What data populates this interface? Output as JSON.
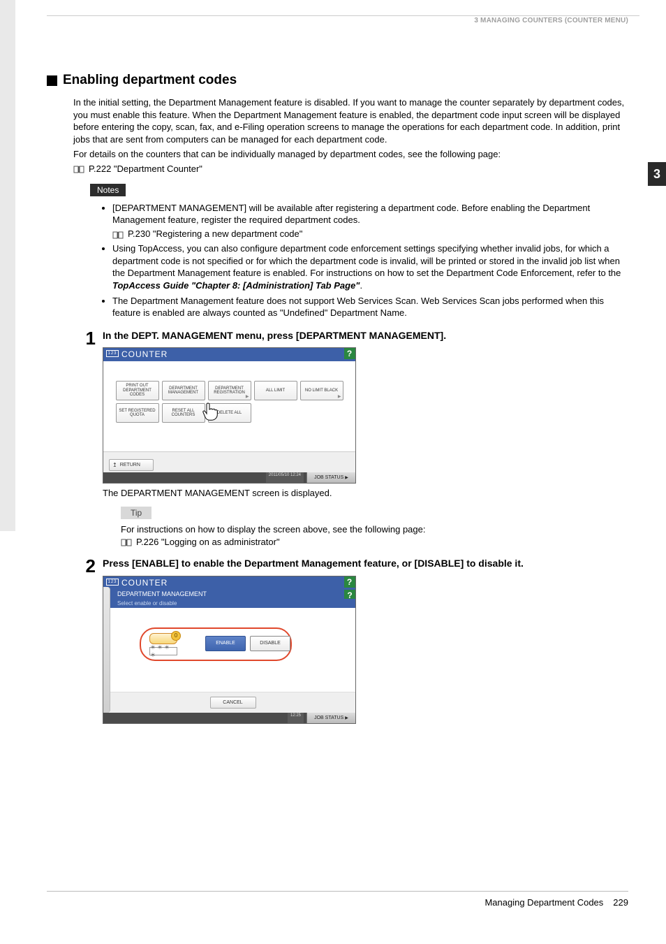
{
  "header": {
    "running_head": "3 MANAGING COUNTERS (COUNTER MENU)",
    "chapter_tab": "3"
  },
  "section": {
    "title": "Enabling department codes",
    "intro": "In the initial setting, the Department Management feature is disabled. If you want to manage the counter separately by department codes, you must enable this feature. When the Department Management feature is enabled, the department code input screen will be displayed before entering the copy, scan, fax, and e-Filing operation screens to manage the operations for each department code. In addition, print jobs that are sent from computers can be managed for each department code.",
    "detail_line": "For details on the counters that can be individually managed by department codes, see the following page:",
    "link1": "P.222 \"Department Counter\""
  },
  "notes": {
    "label": "Notes",
    "items": [
      {
        "text": "[DEPARTMENT MANAGEMENT] will be available after registering a department code. Before enabling the Department Management feature, register the required department codes.",
        "link": "P.230 \"Registering a new department code\""
      },
      {
        "text_a": "Using TopAccess, you can also configure department code enforcement settings specifying whether invalid jobs, for which a department code is not specified or for which the department code is invalid, will be printed or stored in the invalid job list when the Department Management feature is enabled. For instructions on how to set the Department Code Enforcement, refer to the ",
        "text_ref": "TopAccess Guide \"Chapter 8: [Administration] Tab Page\"",
        "text_b": "."
      },
      {
        "text": "The Department Management feature does not support Web Services Scan. Web Services Scan jobs performed when this feature is enabled are always counted as \"Undefined\" Department Name."
      }
    ]
  },
  "steps": [
    {
      "num": "1",
      "title": "In the DEPT. MANAGEMENT menu, press [DEPARTMENT MANAGEMENT].",
      "caption": "The DEPARTMENT MANAGEMENT screen is displayed.",
      "tip": {
        "label": "Tip",
        "text": "For instructions on how to display the screen above, see the following page:",
        "link": "P.226 \"Logging on as administrator\""
      }
    },
    {
      "num": "2",
      "title": "Press [ENABLE] to enable the Department Management feature, or [DISABLE] to disable it."
    }
  ],
  "panel1": {
    "title": "COUNTER",
    "cnt_icon": "123",
    "help": "?",
    "buttons": [
      "PRINT OUT DEPARTMENT CODES",
      "DEPARTMENT MANAGEMENT",
      "DEPARTMENT REGISTRATION",
      "ALL LIMIT",
      "NO LIMIT BLACK",
      "SET REGISTERED QUOTA",
      "RESET ALL COUNTERS",
      "DELETE ALL"
    ],
    "return": "RETURN",
    "timestamp": "2011/05/10\n12:24",
    "job_status": "JOB STATUS"
  },
  "panel2": {
    "title": "COUNTER",
    "cnt_icon": "123",
    "subtitle": "DEPARTMENT MANAGEMENT",
    "prompt": "Select enable or disable",
    "help": "?",
    "asterisks": "＊＊＊＊",
    "enable": "ENABLE",
    "disable": "DISABLE",
    "cancel": "CANCEL",
    "timestamp": "12:25",
    "job_status": "JOB STATUS"
  },
  "footer": {
    "label": "Managing Department Codes",
    "page": "229"
  }
}
